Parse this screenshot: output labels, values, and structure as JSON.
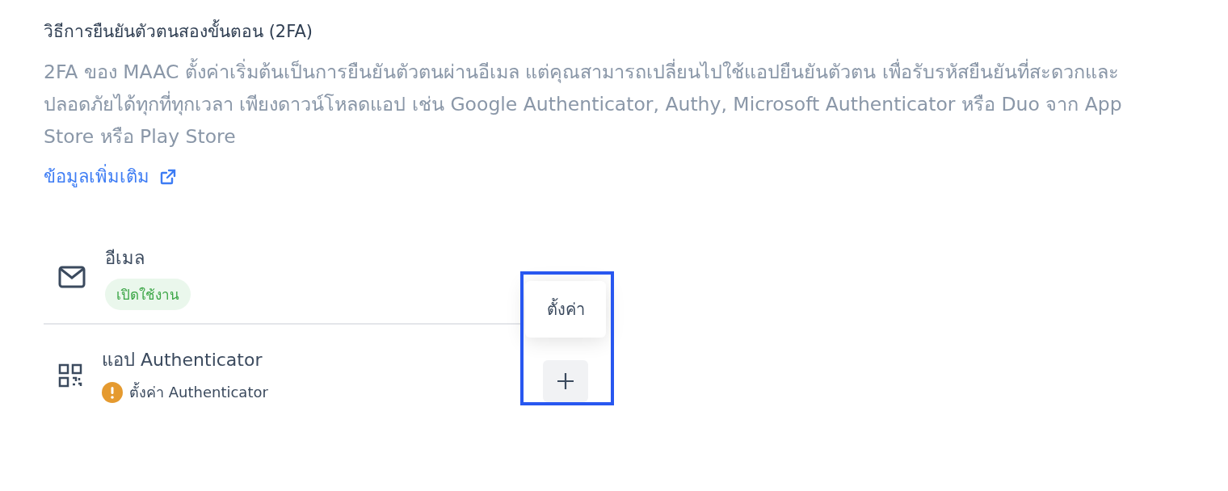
{
  "section": {
    "title": "วิธีการยืนยันตัวตนสองขั้นตอน (2FA)",
    "description": "2FA ของ MAAC ตั้งค่าเริ่มต้นเป็นการยืนยันตัวตนผ่านอีเมล แต่คุณสามารถเปลี่ยนไปใช้แอปยืนยันตัวตน เพื่อรับรหัสยืนยันที่สะดวกและปลอดภัยได้ทุกที่ทุกเวลา เพียงดาวน์โหลดแอป เช่น Google Authenticator, Authy, Microsoft Authenticator หรือ Duo จาก App Store หรือ Play Store",
    "link": "ข้อมูลเพิ่มเติม"
  },
  "methods": [
    {
      "kind": "email",
      "name": "อีเมล",
      "status": {
        "kind": "enabled",
        "label": "เปิดใช้งาน"
      }
    },
    {
      "kind": "authenticator",
      "name": "แอป Authenticator",
      "status": {
        "kind": "warning",
        "label": "ตั้งค่า Authenticator"
      },
      "action": {
        "tooltip": "ตั้งค่า",
        "highlighted": true
      }
    }
  ]
}
